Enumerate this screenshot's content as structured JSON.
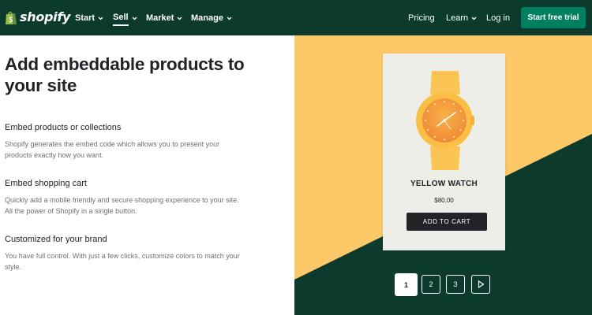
{
  "header": {
    "logo_text": "shopify",
    "nav_items": [
      {
        "label": "Start"
      },
      {
        "label": "Sell"
      },
      {
        "label": "Market"
      },
      {
        "label": "Manage"
      }
    ],
    "right_items": [
      {
        "label": "Pricing"
      },
      {
        "label": "Learn"
      },
      {
        "label": "Log in"
      }
    ],
    "cta_label": "Start free trial",
    "active_nav": "Sell"
  },
  "content": {
    "title": "Add embeddable products to your site",
    "features": [
      {
        "title": "Embed products or collections",
        "description": "Shopify generates the embed code which allows you to present your products exactly how you want."
      },
      {
        "title": "Embed shopping cart",
        "description": "Quickly add a mobile friendly and secure shopping experience to your site. All the power of Shopify in a single button."
      },
      {
        "title": "Customized for your brand",
        "description": "You have full control. With just a few clicks, customize colors to match your style."
      }
    ]
  },
  "product_card": {
    "name": "YELLOW WATCH",
    "price": "$80.00",
    "button_label": "ADD TO CART",
    "image_icon": "yellow-watch-illustration"
  },
  "pagination": {
    "pages": [
      "1",
      "2",
      "3"
    ],
    "active_page": "1",
    "next_icon": "play-triangle-icon"
  },
  "colors": {
    "header_bg": "#0c3b2e",
    "cta_bg": "#008060",
    "showcase_yellow": "#fdc968",
    "showcase_green": "#0c3b2e",
    "card_bg": "#eeeee8",
    "button_dark": "#212326",
    "watch_orange": "#f7a93a"
  }
}
